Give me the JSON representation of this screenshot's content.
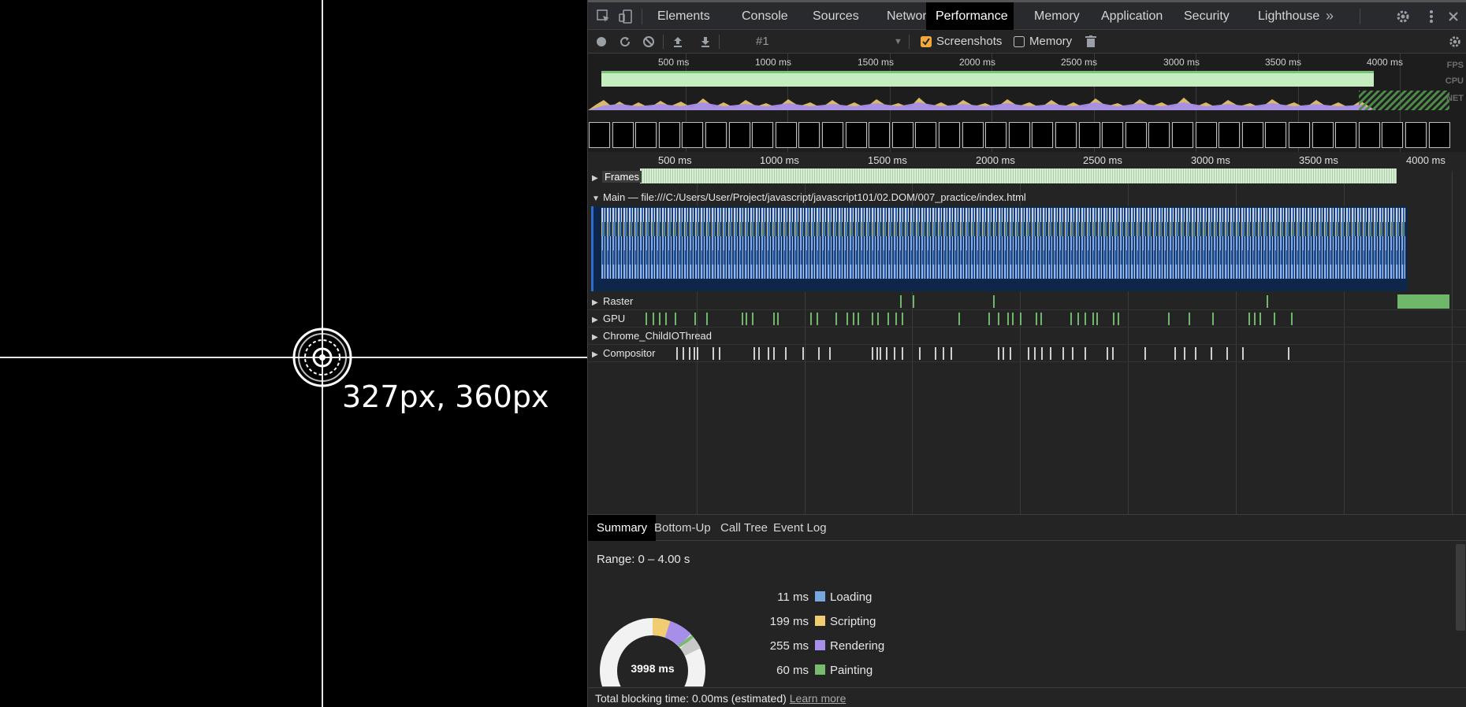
{
  "page": {
    "coordinate_readout": "327px, 360px"
  },
  "devtools": {
    "tabs": [
      {
        "label": "Elements"
      },
      {
        "label": "Console"
      },
      {
        "label": "Sources"
      },
      {
        "label": "Network"
      },
      {
        "label": "Performance"
      },
      {
        "label": "Memory"
      },
      {
        "label": "Application"
      },
      {
        "label": "Security"
      },
      {
        "label": "Lighthouse"
      }
    ],
    "active_tab": "Performance",
    "more_tabs": "»",
    "toolbar": {
      "recording_select": "#1",
      "screenshots_label": "Screenshots",
      "screenshots_checked": true,
      "memory_label": "Memory",
      "memory_checked": false
    },
    "overview": {
      "ticks": [
        "500 ms",
        "1000 ms",
        "1500 ms",
        "2000 ms",
        "2500 ms",
        "3000 ms",
        "3500 ms",
        "4000 ms"
      ],
      "labels": {
        "fps": "FPS",
        "cpu": "CPU",
        "net": "NET"
      }
    },
    "timeline": {
      "ticks": [
        "500 ms",
        "1000 ms",
        "1500 ms",
        "2000 ms",
        "2500 ms",
        "3000 ms",
        "3500 ms",
        "4000 ms"
      ],
      "tracks": {
        "frames": "Frames",
        "main": "Main — file:///C:/Users/User/Project/javascript/javascript101/02.DOM/007_practice/index.html",
        "raster": "Raster",
        "gpu": "GPU",
        "io": "Chrome_ChildIOThread",
        "compositor": "Compositor"
      }
    },
    "bottom": {
      "tabs": [
        "Summary",
        "Bottom-Up",
        "Call Tree",
        "Event Log"
      ],
      "active_tab": "Summary",
      "range": "Range: 0 – 4.00 s",
      "total": "3998 ms",
      "categories": [
        {
          "value": "11 ms",
          "label": "Loading",
          "color": "#7aa6e0"
        },
        {
          "value": "199 ms",
          "label": "Scripting",
          "color": "#f0cc73"
        },
        {
          "value": "255 ms",
          "label": "Rendering",
          "color": "#a78ee8"
        },
        {
          "value": "60 ms",
          "label": "Painting",
          "color": "#79b970"
        }
      ],
      "footer_text": "Total blocking time: 0.00ms (estimated)",
      "footer_link": "Learn more"
    }
  },
  "colors": {
    "page_bg": "#000000",
    "devtools_bg": "#242424",
    "fps_green": "#c5eec0",
    "main_track_bg": "#0e2649",
    "gpu_green": "#6fb86a"
  }
}
